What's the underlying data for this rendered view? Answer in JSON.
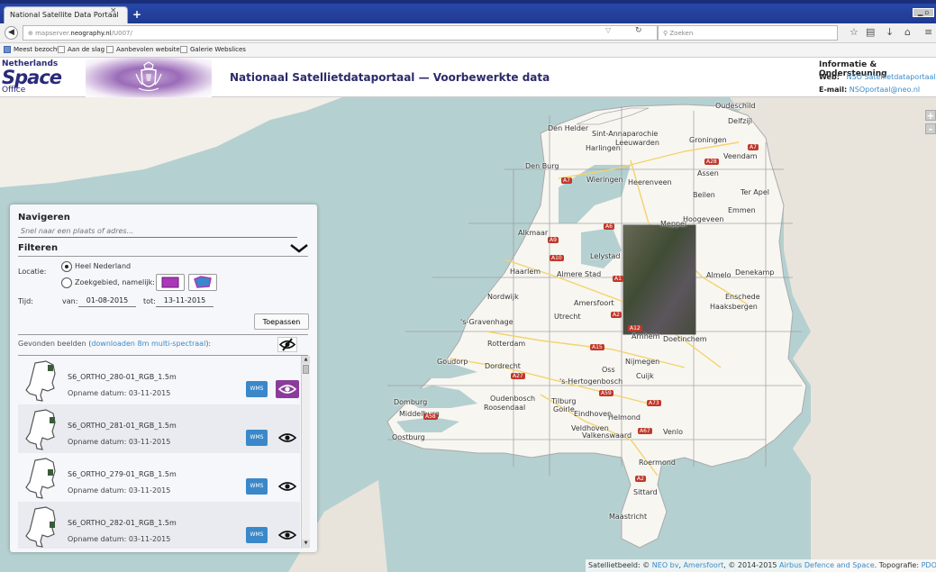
{
  "browser": {
    "tab_title": "National Satellite Data Portaal",
    "tab_close": "×",
    "new_tab": "+",
    "url_prefix": "mapserver.",
    "url_domain": "neography.nl",
    "url_path": "/U007/",
    "search_placeholder": "Zoeken",
    "bookmarks": [
      "Meest bezocht",
      "Aan de slag",
      "Aanbevolen websites",
      "Galerie Webslices"
    ],
    "icons": [
      "star-icon",
      "clipboard-icon",
      "download-icon",
      "home-icon",
      "menu-icon"
    ]
  },
  "header": {
    "logo_line1": "Netherlands",
    "logo_line2": "Space",
    "logo_line3": "Office",
    "title": "Nationaal Satellietdataportaal — Voorbewerkte data",
    "info_title": "Informatie & Ondersteuning",
    "web_label": "Web:",
    "web_link": "NSO Satellietdataportaal",
    "mail_label": "E-mail:",
    "mail_link": "NSOportaal@neo.nl"
  },
  "map": {
    "zoom_in": "+",
    "zoom_out": "-",
    "cities": [
      "Oudeschild",
      "Delfzijl",
      "Den Helder",
      "Sint-Annaparochie",
      "Leeuwarden",
      "Harlingen",
      "Groningen",
      "Veendam",
      "Den Burg",
      "Assen",
      "Heerenveen",
      "Wieringen",
      "Emmen",
      "Ter Apel",
      "Beilen",
      "Meppel",
      "Hoogeveen",
      "Alkmaar",
      "Lelystad",
      "Almere Stad",
      "Haarlem",
      "Denekamp",
      "Almelo",
      "Nordwijk",
      "Enschede",
      "Haaksbergen",
      "Amersfoort",
      "Utrecht",
      "'s-Gravenhage",
      "Rotterdam",
      "Arnhem",
      "Doetinchem",
      "Oss",
      "Nijmegen",
      "Cuijk",
      "Goudorp",
      "Dordrecht",
      "'s-Hertogenbosch",
      "Oudenbosch",
      "Tilburg",
      "Roosendaal",
      "Goirle",
      "Helmond",
      "Eindhoven",
      "Domburg",
      "Middelburg",
      "Venlo",
      "Veldhoven",
      "Valkenswaard",
      "Oostburg",
      "Roermond",
      "Sittard",
      "Maastricht"
    ],
    "roads": [
      "A7",
      "A7",
      "A28",
      "A6",
      "A9",
      "A10",
      "A1",
      "A12",
      "A15",
      "A2",
      "A27",
      "A58",
      "A59",
      "A73",
      "A67",
      "A2"
    ],
    "attribution_prefix": "Satellietbeeld: ©",
    "attribution_neo": "NEO bv",
    "attribution_sep1": ", ",
    "attribution_city": "Amersfoort",
    "attribution_mid": ", © 2014-2015",
    "attribution_airbus": "Airbus Defence and Space",
    "attribution_topo": ". Topografie:",
    "attribution_pdok": "PDOK"
  },
  "panel": {
    "nav_title": "Navigeren",
    "address_placeholder": "Snel naar een plaats of adres...",
    "filter_title": "Filteren",
    "location_label": "Locatie:",
    "option_all": "Heel Nederland",
    "option_area": "Zoekgebied, namelijk:",
    "time_label": "Tijd:",
    "from_label": "van:",
    "from_date": "01-08-2015",
    "to_label": "tot:",
    "to_date": "13-11-2015",
    "apply_label": "Toepassen",
    "found_prefix": "Gevonden beelden (",
    "found_link": "downloaden 8m multi-spectraal",
    "found_suffix": "):",
    "wms_label": "WMS",
    "date_prefix": "Opname datum:",
    "items": [
      {
        "name": "S6_ORTHO_280-01_RGB_1.5m",
        "date": "03-11-2015",
        "active": true
      },
      {
        "name": "S6_ORTHO_281-01_RGB_1.5m",
        "date": "03-11-2015",
        "active": false
      },
      {
        "name": "S6_ORTHO_279-01_RGB_1.5m",
        "date": "03-11-2015",
        "active": false
      },
      {
        "name": "S6_ORTHO_282-01_RGB_1.5m",
        "date": "03-11-2015",
        "active": false
      }
    ]
  },
  "colors": {
    "accent_purple": "#8b3c9b",
    "wms_blue": "#3a88c9",
    "link_blue": "#3a8bc9",
    "title_navy": "#2b2b6b"
  }
}
